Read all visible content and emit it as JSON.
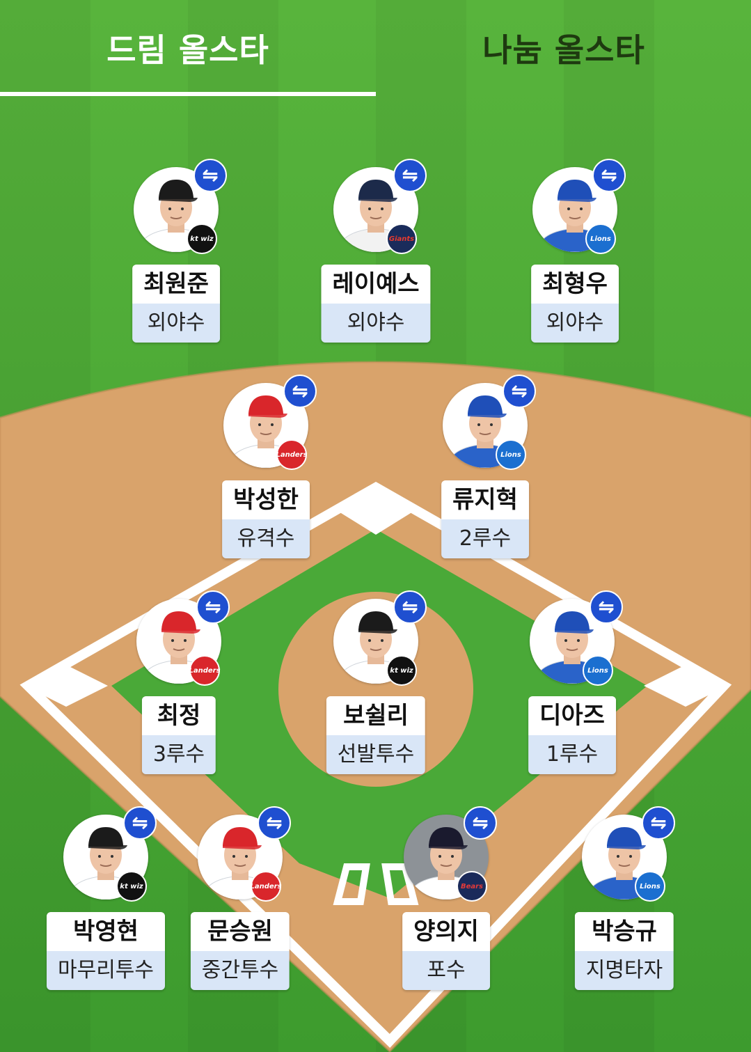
{
  "tabs": [
    {
      "label": "드림 올스타",
      "active": true
    },
    {
      "label": "나눔 올스타",
      "active": false
    }
  ],
  "swap_icon": "⇋",
  "colors": {
    "grass": "#47a936",
    "grass_stripe": "#3e9a2f",
    "infield_dirt": "#d9a36b",
    "swap_button": "#1f4fd0",
    "name_bg": "#ffffff",
    "position_bg": "#d9e6f7"
  },
  "players": [
    {
      "name": "최원준",
      "position": "외야수",
      "team": "kt wiz",
      "cap": "#1b1b1b",
      "jersey": "#ffffff",
      "logo_bg": "#111111",
      "logo_fg": "#ffffff"
    },
    {
      "name": "레이예스",
      "position": "외야수",
      "team": "Giants",
      "cap": "#1c2a4a",
      "jersey": "#f2f2f2",
      "logo_bg": "#1a2c5b",
      "logo_fg": "#e63a2e"
    },
    {
      "name": "최형우",
      "position": "외야수",
      "team": "Lions",
      "cap": "#1f4fb8",
      "jersey": "#2a63c9",
      "logo_bg": "#1b6fd0",
      "logo_fg": "#ffffff"
    },
    {
      "name": "박성한",
      "position": "유격수",
      "team": "Landers",
      "cap": "#d9262b",
      "jersey": "#ffffff",
      "logo_bg": "#d9262b",
      "logo_fg": "#ffffff"
    },
    {
      "name": "류지혁",
      "position": "2루수",
      "team": "Lions",
      "cap": "#1f4fb8",
      "jersey": "#2a63c9",
      "logo_bg": "#1b6fd0",
      "logo_fg": "#ffffff"
    },
    {
      "name": "최정",
      "position": "3루수",
      "team": "Landers",
      "cap": "#d9262b",
      "jersey": "#ffffff",
      "logo_bg": "#d9262b",
      "logo_fg": "#ffffff"
    },
    {
      "name": "보쉴리",
      "position": "선발투수",
      "team": "kt wiz",
      "cap": "#1b1b1b",
      "jersey": "#ffffff",
      "logo_bg": "#111111",
      "logo_fg": "#ffffff"
    },
    {
      "name": "디아즈",
      "position": "1루수",
      "team": "Lions",
      "cap": "#1f4fb8",
      "jersey": "#2a63c9",
      "logo_bg": "#1b6fd0",
      "logo_fg": "#ffffff"
    },
    {
      "name": "박영현",
      "position": "마무리투수",
      "team": "kt wiz",
      "cap": "#1b1b1b",
      "jersey": "#ffffff",
      "logo_bg": "#111111",
      "logo_fg": "#ffffff"
    },
    {
      "name": "문승원",
      "position": "중간투수",
      "team": "Landers",
      "cap": "#d9262b",
      "jersey": "#ffffff",
      "logo_bg": "#d9262b",
      "logo_fg": "#ffffff"
    },
    {
      "name": "양의지",
      "position": "포수",
      "team": "Bears",
      "cap": "#1a1a2e",
      "jersey": "#ffffff",
      "logo_bg": "#1a2a5a",
      "logo_fg": "#e23a3a"
    },
    {
      "name": "박승규",
      "position": "지명타자",
      "team": "Lions",
      "cap": "#1f4fb8",
      "jersey": "#2a63c9",
      "logo_bg": "#1b6fd0",
      "logo_fg": "#ffffff"
    }
  ]
}
